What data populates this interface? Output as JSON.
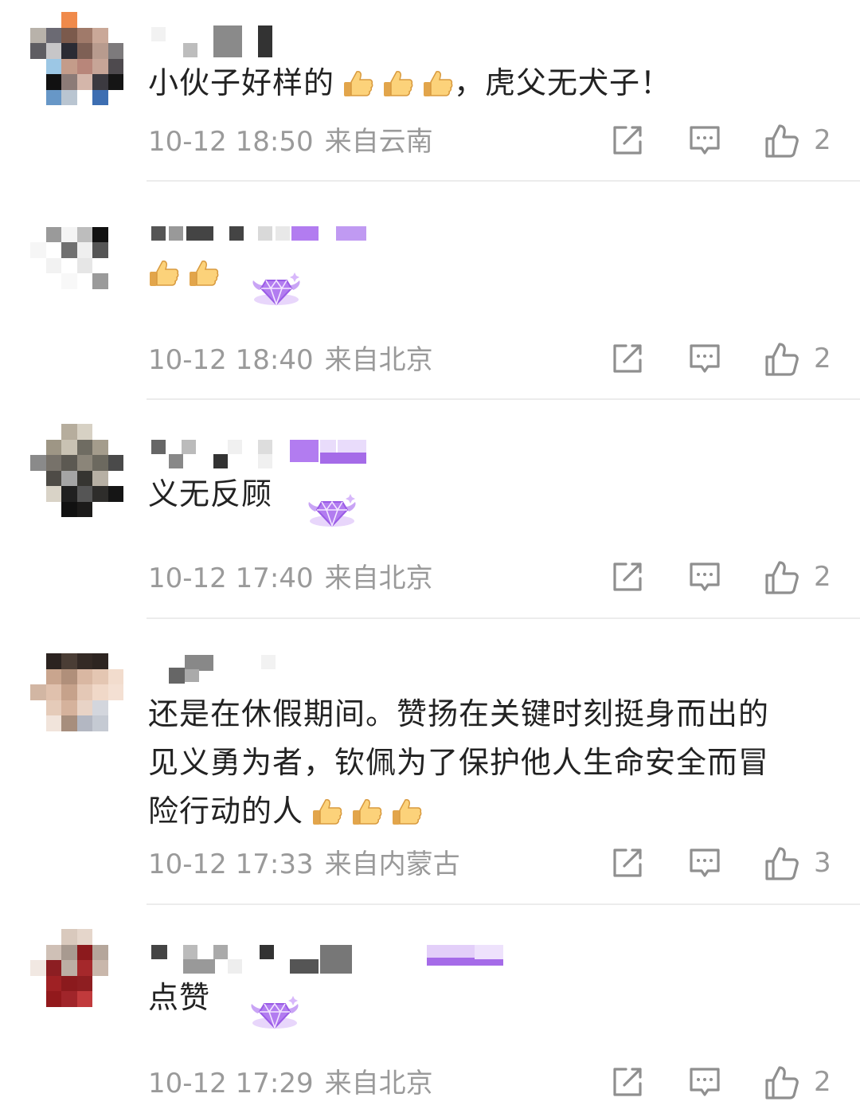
{
  "comments": [
    {
      "text": "小伙子好样的",
      "after_thumbs": "，虎父无犬子！",
      "thumbs": 3,
      "time": "10-12 18:50",
      "location": "来自云南",
      "likes": "2"
    },
    {
      "text": "",
      "after_thumbs": "",
      "thumbs": 2,
      "time": "10-12 18:40",
      "location": "来自北京",
      "likes": "2"
    },
    {
      "text": "义无反顾",
      "after_thumbs": "",
      "thumbs": 0,
      "time": "10-12 17:40",
      "location": "来自北京",
      "likes": "2"
    },
    {
      "text_lines": [
        "还是在休假期间。赞扬在关键时刻挺身而出的",
        "见义勇为者，钦佩为了保护他人生命安全而冒",
        "险行动的人"
      ],
      "thumbs": 3,
      "time": "10-12 17:33",
      "location": "来自内蒙古",
      "likes": "3"
    },
    {
      "text": "点赞",
      "after_thumbs": "",
      "thumbs": 0,
      "time": "10-12 17:29",
      "location": "来自北京",
      "likes": "2"
    }
  ],
  "icons": {
    "share": "share-icon",
    "reply": "comment-icon",
    "like": "thumbs-up-icon",
    "thumb_emoji": "thumbs-up-emoji-icon",
    "badge": "gem-badge-icon"
  },
  "colors": {
    "text": "#222222",
    "meta": "#9a9a9a",
    "badge": "#b27cf0",
    "divider": "#ececec"
  }
}
